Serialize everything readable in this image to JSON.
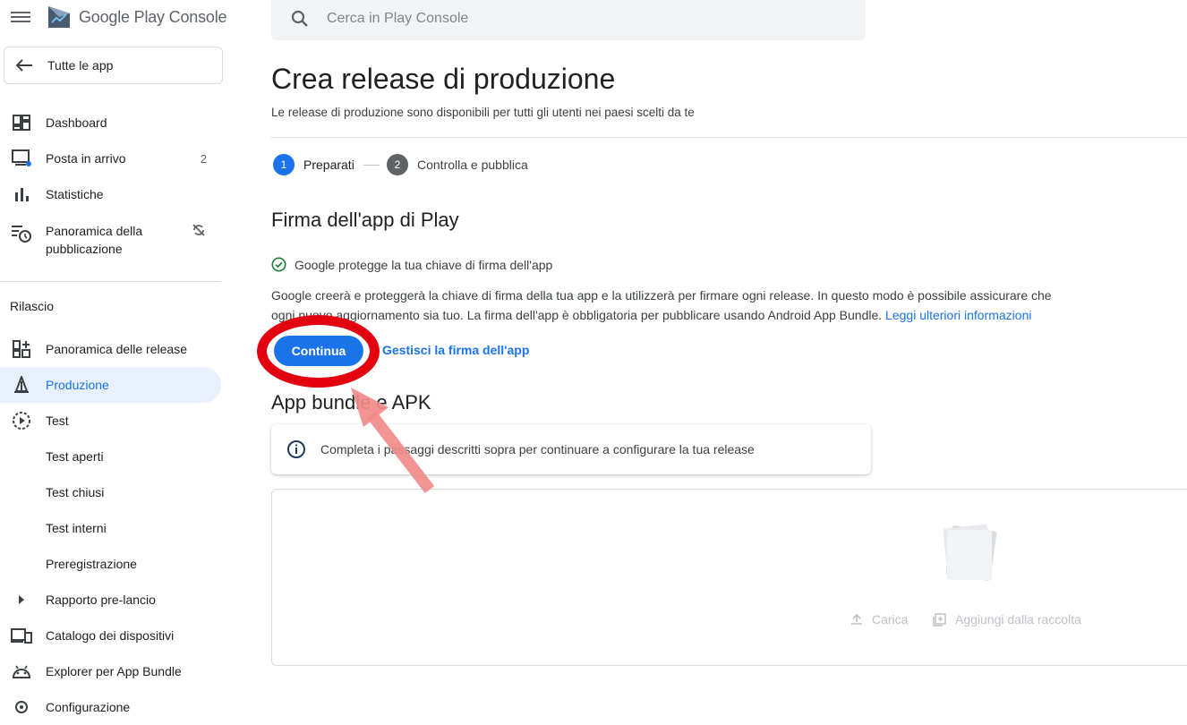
{
  "header": {
    "app_name": "Google Play Console",
    "search_placeholder": "Cerca in Play Console"
  },
  "sidebar": {
    "all_apps_label": "Tutte le app",
    "items": [
      {
        "label": "Dashboard",
        "icon": "dashboard-icon"
      },
      {
        "label": "Posta in arrivo",
        "icon": "inbox-icon",
        "badge": "2"
      },
      {
        "label": "Statistiche",
        "icon": "bar-chart-icon"
      },
      {
        "label": "Panoramica della pubblicazione",
        "icon": "schedule-list-icon"
      }
    ],
    "section_label": "Rilascio",
    "release_items": [
      {
        "label": "Panoramica delle release",
        "icon": "dashboard-add-icon"
      },
      {
        "label": "Produzione",
        "icon": "production-icon",
        "active": true
      },
      {
        "label": "Test",
        "icon": "play-circle-icon"
      },
      {
        "label": "Test aperti"
      },
      {
        "label": "Test chiusi"
      },
      {
        "label": "Test interni"
      },
      {
        "label": "Preregistrazione"
      },
      {
        "label": "Rapporto pre-lancio",
        "icon": "caret-right-icon"
      },
      {
        "label": "Catalogo dei dispositivi",
        "icon": "devices-icon"
      },
      {
        "label": "Explorer per App Bundle",
        "icon": "android-icon"
      },
      {
        "label": "Configurazione",
        "icon": "gear-icon"
      }
    ]
  },
  "main": {
    "title": "Crea release di produzione",
    "subtitle": "Le release di produzione sono disponibili per tutti gli utenti nei paesi scelti da te",
    "steps": [
      {
        "num": "1",
        "label": "Preparati",
        "active": true
      },
      {
        "num": "2",
        "label": "Controlla e pubblica",
        "active": false
      }
    ],
    "signing": {
      "heading": "Firma dell'app di Play",
      "status": "Google protegge la tua chiave di firma dell'app",
      "description": "Google creerà e proteggerà la chiave di firma della tua app e la utilizzerà per firmare ogni release. In questo modo è possibile assicurare che ogni nuovo aggiornamento sia tuo. La firma dell'app è obbligatoria per pubblicare usando Android App Bundle.",
      "learn_more": "Leggi ulteriori informazioni",
      "continue_button": "Continua",
      "manage_link": "Gestisci la firma dell'app"
    },
    "bundles": {
      "heading": "App bundle e APK",
      "info": "Completa i passaggi descritti sopra per continuare a configurare la tua release",
      "upload_label": "Carica",
      "library_label": "Aggiungi dalla raccolta"
    }
  },
  "colors": {
    "accent": "#1a73e8",
    "annotation": "#e3000f",
    "arrow": "#f28b8b"
  }
}
